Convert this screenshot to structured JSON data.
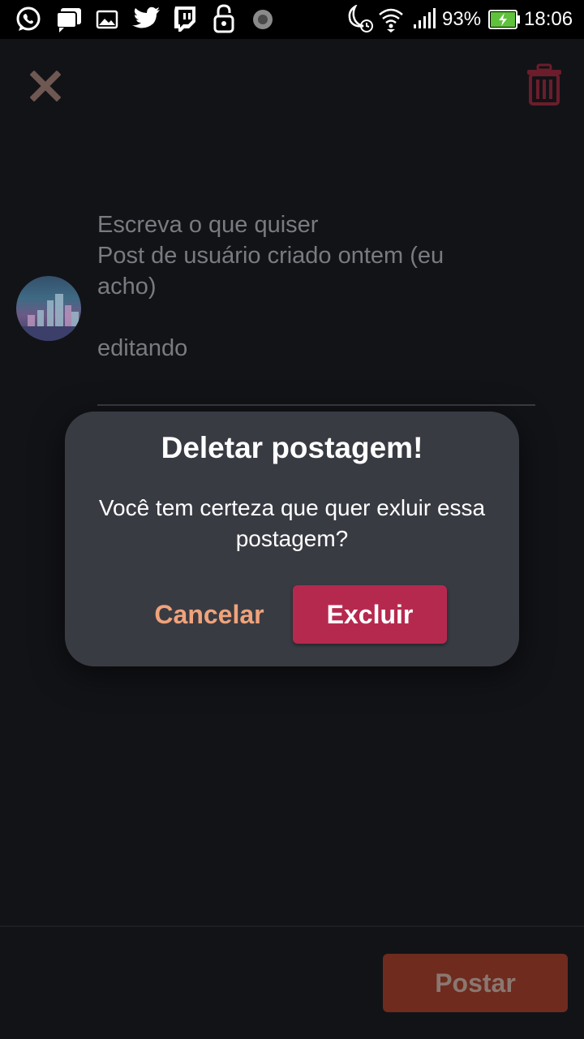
{
  "status_bar": {
    "icons": [
      "whatsapp-icon",
      "chat-icon",
      "image-icon",
      "twitter-icon",
      "twitch-icon",
      "lock-icon",
      "sync-icon"
    ],
    "right_icons": [
      "moon-alarm-icon",
      "wifi-icon",
      "signal-icon",
      "battery-charging-icon"
    ],
    "battery": "93%",
    "time": "18:06"
  },
  "toolbar": {
    "close_icon": "close-icon",
    "delete_icon": "trash-icon"
  },
  "composer": {
    "placeholder": "Escreva o que quiser",
    "lines": [
      "Post de usuário criado ontem (eu",
      "acho)",
      "",
      "editando"
    ]
  },
  "dialog": {
    "title": "Deletar postagem!",
    "message": "Você tem certeza que quer exluir essa postagem?",
    "cancel_label": "Cancelar",
    "confirm_label": "Excluir"
  },
  "footer": {
    "post_label": "Postar"
  },
  "colors": {
    "background": "#121317",
    "dialog": "#393b43",
    "confirm": "#b6294f",
    "cancel_text": "#f0a37a",
    "post_button": "#6e2b1e"
  }
}
